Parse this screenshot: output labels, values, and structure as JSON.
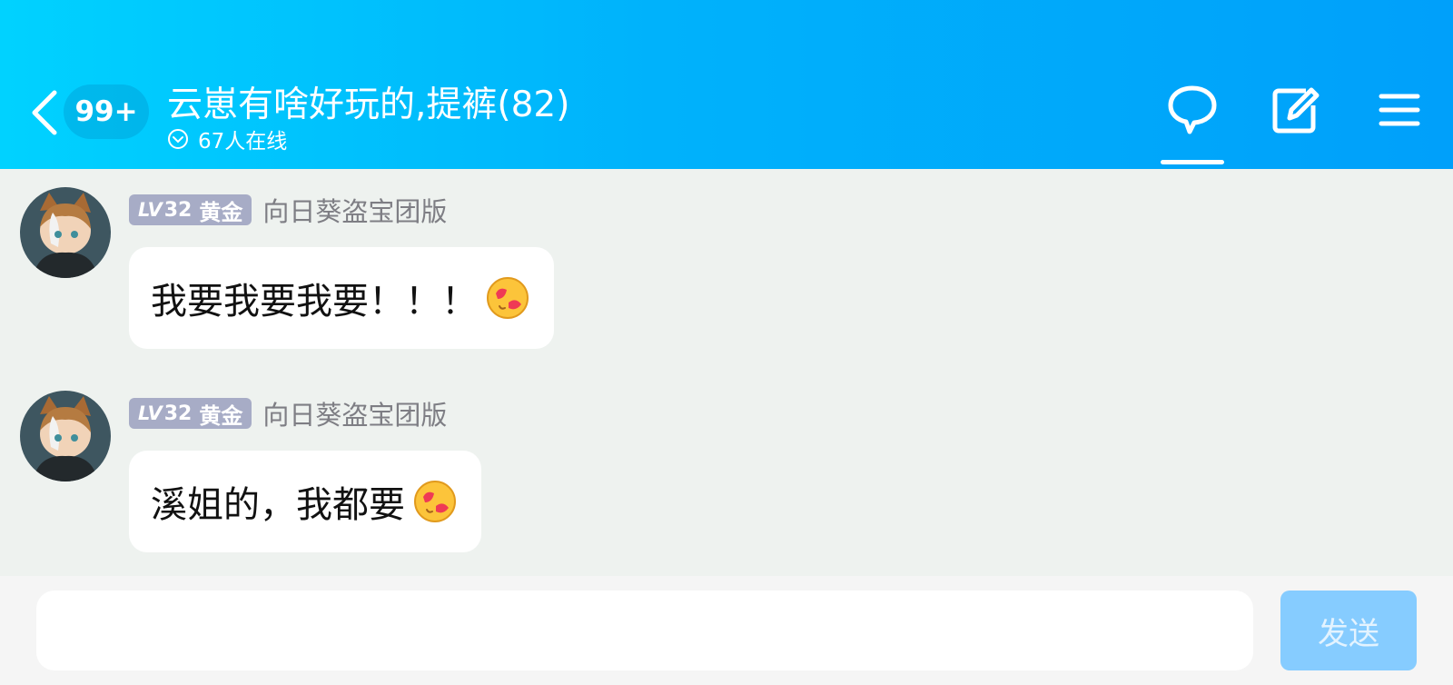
{
  "header": {
    "unread_badge": "99+",
    "title": "云崽有啥好玩的,提裤(82)",
    "online_count": "67人在线",
    "icons": [
      "back-arrow-icon",
      "chat-bubble-icon",
      "edit-icon",
      "menu-icon"
    ],
    "active_tab": "chat"
  },
  "messages": [
    {
      "level_prefix": "LV",
      "level_number": "32",
      "level_title": "黄金",
      "sender": "向日葵盗宝团版",
      "text": "我要我要我要！！！",
      "emoji": "heart-eyes-emoji"
    },
    {
      "level_prefix": "LV",
      "level_number": "32",
      "level_title": "黄金",
      "sender": "向日葵盗宝团版",
      "text": "溪姐的，我都要",
      "emoji": "heart-eyes-emoji"
    }
  ],
  "composer": {
    "input_value": "",
    "input_placeholder": "",
    "send_label": "发送"
  },
  "colors": {
    "header_gradient_start": "#00d2ff",
    "header_gradient_end": "#00a0fa",
    "background": "#eef2ef",
    "level_badge": "#a7acc6",
    "send_button": "#86ccff"
  }
}
